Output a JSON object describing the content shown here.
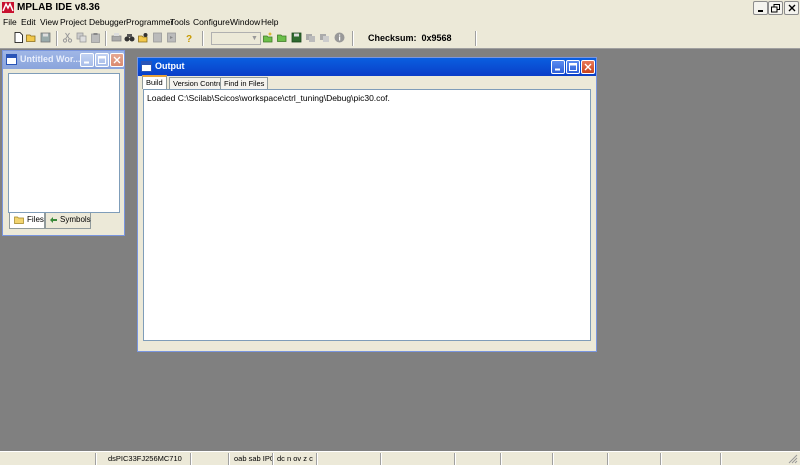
{
  "app": {
    "title": "MPLAB IDE v8.36"
  },
  "menu": [
    "File",
    "Edit",
    "View",
    "Project",
    "Debugger",
    "Programmer",
    "Tools",
    "Configure",
    "Window",
    "Help"
  ],
  "toolbar": {
    "checksum_label": "Checksum:",
    "checksum_value": "0x9568",
    "combo_value": ""
  },
  "workspace": {
    "title": "Untitled Wor...",
    "tabs": [
      "Files",
      "Symbols"
    ]
  },
  "output": {
    "title": "Output",
    "tabs": [
      "Build",
      "Version Control",
      "Find in Files"
    ],
    "lines": [
      "Loaded C:\\Scilab\\Scicos\\workspace\\ctrl_tuning\\Debug\\pic30.cof."
    ]
  },
  "status": {
    "device": "dsPIC33FJ256MC710",
    "flags1": "oab sab IP0",
    "flags2": "dc n ov z c"
  },
  "colors": {
    "titlebar_active": "#0a3ec8",
    "desktop": "#808080",
    "chrome": "#ece9d8"
  }
}
